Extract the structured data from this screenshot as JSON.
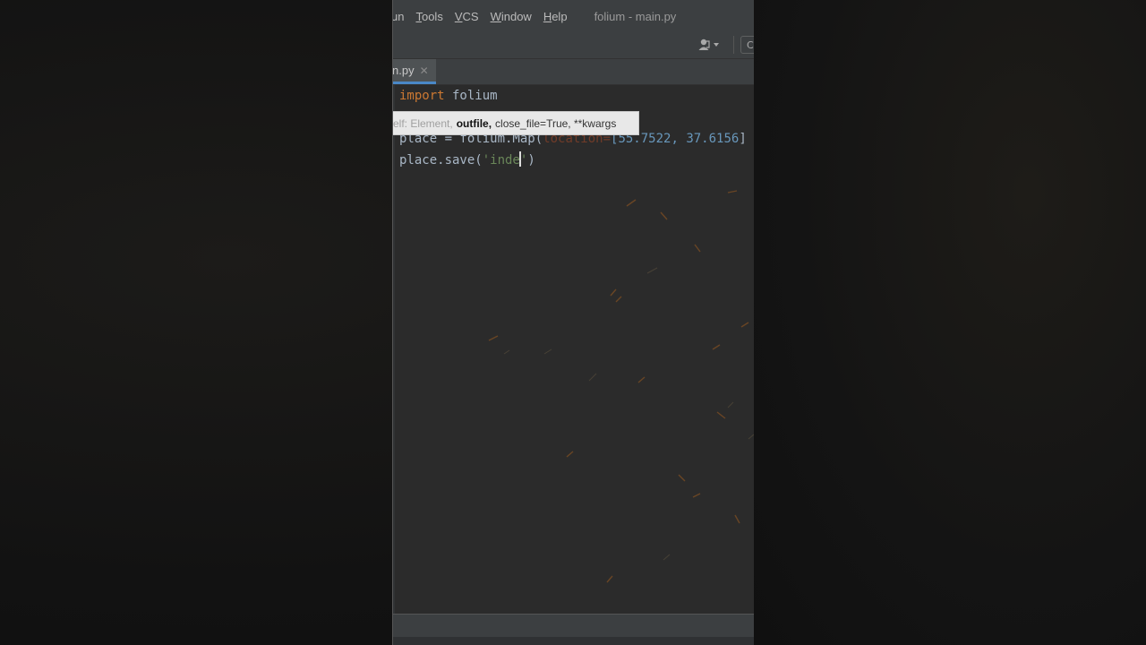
{
  "menubar": {
    "items": [
      "un",
      "Tools",
      "VCS",
      "Window",
      "Help"
    ],
    "window_title": "folium - main.py"
  },
  "toolbar": {
    "user_icon": "user-icon",
    "button_glyph": "C"
  },
  "tabs": [
    {
      "label": "n.py",
      "active": true
    }
  ],
  "editor": {
    "line1": {
      "keyword": "import",
      "text": " folium"
    },
    "line2": {
      "prefix": "place = folium.Map(",
      "param": "location=",
      "bracket": "[",
      "num1": "55.7522",
      "sep": ", ",
      "num2": "37.6156",
      "suffix": "]"
    },
    "line3": {
      "prefix": "place.save(",
      "string_before": "'inde",
      "string_after": "'",
      "suffix": ")"
    }
  },
  "tooltip": {
    "dim": "elf: Element,",
    "bold": "outfile,",
    "rest": "close_file=True, **kwargs"
  },
  "colors": {
    "keyword": "#cc7832",
    "number": "#6897bb",
    "string": "#6a8759",
    "accent": "#4a88c7"
  }
}
